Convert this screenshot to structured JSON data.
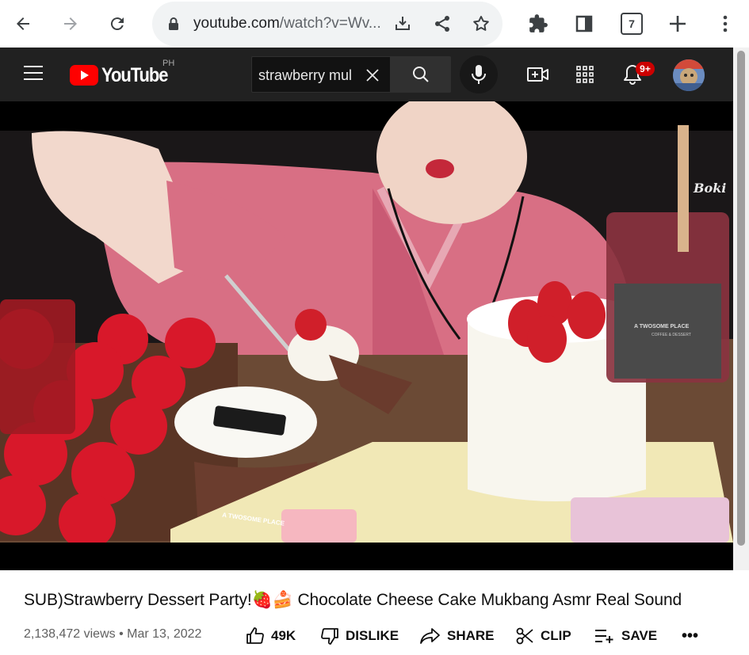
{
  "browser": {
    "url_host": "youtube.com",
    "url_path": "/watch?v=Wv...",
    "tab_count": "7"
  },
  "masthead": {
    "logo_text": "YouTube",
    "region": "PH",
    "search_value": "strawberry mul",
    "notification_count": "9+"
  },
  "video": {
    "brand_text": "A TWOSOME PLACE",
    "brand_sub": "COFFEE & DESSERT",
    "watermark": "Boki"
  },
  "info": {
    "title": "SUB)Strawberry Dessert Party!🍓🍰 Chocolate Cheese Cake Mukbang Asmr Real Sound",
    "meta": "2,138,472 views • Mar 13, 2022",
    "like_label": "49K",
    "dislike_label": "DISLIKE",
    "share_label": "SHARE",
    "clip_label": "CLIP",
    "save_label": "SAVE",
    "more_label": "•••"
  },
  "colors": {
    "youtube_red": "#ff0000",
    "masthead_bg": "#212121",
    "badge_red": "#cc0000"
  }
}
